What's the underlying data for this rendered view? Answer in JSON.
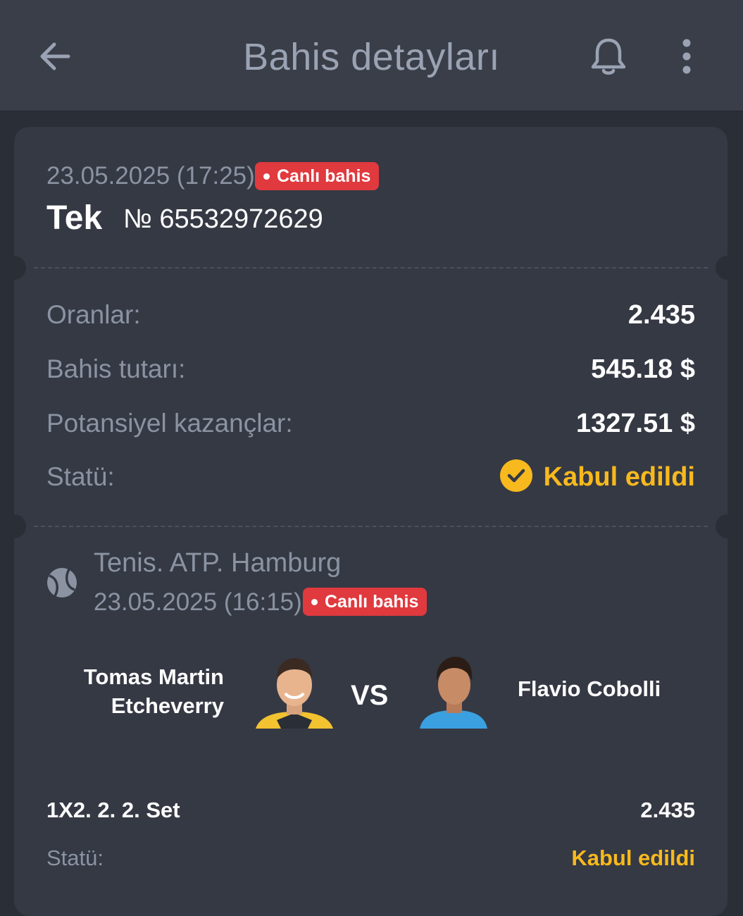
{
  "header": {
    "title": "Bahis detayları",
    "back_icon": "arrow-left-icon",
    "bell_icon": "bell-icon",
    "more_icon": "more-vertical-icon"
  },
  "bet": {
    "date": "23.05.2025 (17:25)",
    "live_label": "Canlı bahis",
    "type": "Tek",
    "number": "№ 65532972629"
  },
  "summary": {
    "odds_label": "Oranlar:",
    "odds_value": "2.435",
    "stake_label": "Bahis tutarı:",
    "stake_value": "545.18 $",
    "potential_label": "Potansiyel kazançlar:",
    "potential_value": "1327.51 $",
    "status_label": "Statü:",
    "status_value": "Kabul edildi"
  },
  "event": {
    "sport_icon": "tennis-ball-icon",
    "league": "Tenis. ATP. Hamburg",
    "date": "23.05.2025 (16:15)",
    "live_label": "Canlı bahis",
    "player1": "Tomas Martin Etcheverry",
    "player2": "Flavio Cobolli",
    "vs": "VS",
    "market": "1X2. 2. 2. Set",
    "market_odds": "2.435",
    "status_label": "Statü:",
    "status_value": "Kabul edildi"
  },
  "colors": {
    "background": "#2a2e36",
    "card": "#353944",
    "live": "#e0393e",
    "accepted": "#f7b91d",
    "muted": "#8b93a2"
  }
}
